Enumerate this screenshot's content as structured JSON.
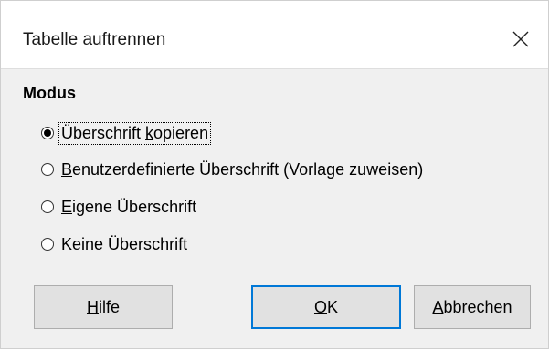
{
  "dialog": {
    "title": "Tabelle auftrennen",
    "close_icon": "close-icon"
  },
  "mode": {
    "label": "Modus",
    "selected_index": 0,
    "options": [
      {
        "pre": "Überschrift ",
        "mnemonic": "k",
        "post": "opieren",
        "checked": true
      },
      {
        "pre": "",
        "mnemonic": "B",
        "post": "enutzerdefinierte Überschrift (Vorlage zuweisen)",
        "checked": false
      },
      {
        "pre": "",
        "mnemonic": "E",
        "post": "igene Überschrift",
        "checked": false
      },
      {
        "pre": "Keine Übers",
        "mnemonic": "c",
        "post": "hrift",
        "checked": false
      }
    ]
  },
  "buttons": {
    "help": {
      "pre": "",
      "mnemonic": "H",
      "post": "ilfe"
    },
    "ok": {
      "pre": "",
      "mnemonic": "O",
      "post": "K"
    },
    "cancel": {
      "pre": "",
      "mnemonic": "A",
      "post": "bbrechen"
    }
  },
  "colors": {
    "accent": "#0078d7",
    "dialog_background": "#f0f0f0",
    "button_background": "#e1e1e1"
  }
}
